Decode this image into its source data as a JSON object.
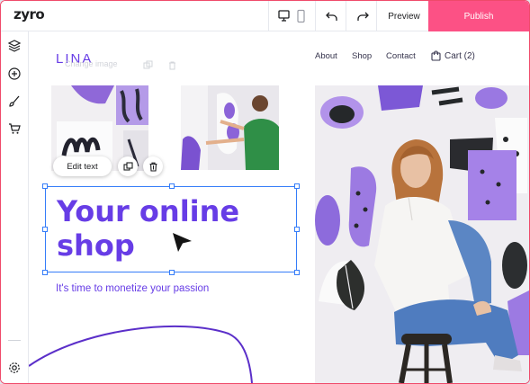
{
  "app": {
    "logo": "zyro",
    "preview_label": "Preview",
    "publish_label": "Publish",
    "accent_color": "#fc5185",
    "selection_color": "#357df9"
  },
  "toolbar_icons": [
    "desktop-icon",
    "mobile-icon",
    "undo-icon",
    "redo-icon"
  ],
  "sidebar_icons": [
    "layers-icon",
    "add-icon",
    "brush-icon",
    "cart-icon",
    "settings-icon"
  ],
  "site": {
    "brand": "LINA",
    "ghost_label": "Change image",
    "nav": {
      "about": "About",
      "shop": "Shop",
      "contact": "Contact",
      "cart": "Cart (2)"
    },
    "headline": "Your online shop",
    "subheadline": "It's time to monetize your passion",
    "brand_color": "#673de6"
  },
  "editor": {
    "edit_text_label": "Edit text"
  }
}
